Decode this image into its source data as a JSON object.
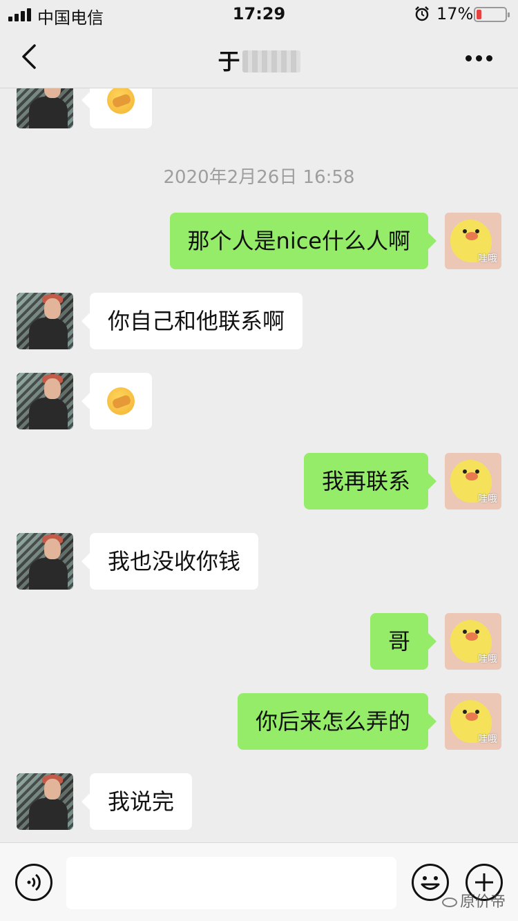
{
  "status_bar": {
    "carrier": "中国电信",
    "time": "17:29",
    "battery_percent": "17%",
    "battery_level": 0.17,
    "alarm_icon": "alarm-clock-icon",
    "battery_color": "#e64340"
  },
  "nav": {
    "title_visible": "于",
    "back_icon": "chevron-left-icon",
    "more_icon": "more-dots-icon"
  },
  "chat": {
    "timestamp": "2020年2月26日 16:58",
    "messages": [
      {
        "sender": "other",
        "type": "emoji",
        "icon": "facepalm-emoji"
      },
      {
        "sender": "self",
        "type": "text",
        "text": "那个人是nice什么人啊",
        "avatar_caption": "哇哦"
      },
      {
        "sender": "other",
        "type": "text",
        "text": "你自己和他联系啊"
      },
      {
        "sender": "other",
        "type": "emoji",
        "icon": "facepalm-emoji"
      },
      {
        "sender": "self",
        "type": "text",
        "text": "我再联系",
        "avatar_caption": "哇哦"
      },
      {
        "sender": "other",
        "type": "text",
        "text": "我也没收你钱"
      },
      {
        "sender": "self",
        "type": "text",
        "text": "哥",
        "avatar_caption": "哇哦"
      },
      {
        "sender": "self",
        "type": "text",
        "text": "你后来怎么弄的",
        "avatar_caption": "哇哦"
      },
      {
        "sender": "other",
        "type": "text",
        "text": "我说完"
      }
    ],
    "bubble_colors": {
      "self": "#95ec69",
      "other": "#ffffff"
    }
  },
  "input_bar": {
    "voice_icon": "voice-icon",
    "emoji_icon": "smiley-icon",
    "plus_icon": "plus-icon",
    "input_value": ""
  },
  "watermark": {
    "text": "原价帝"
  }
}
